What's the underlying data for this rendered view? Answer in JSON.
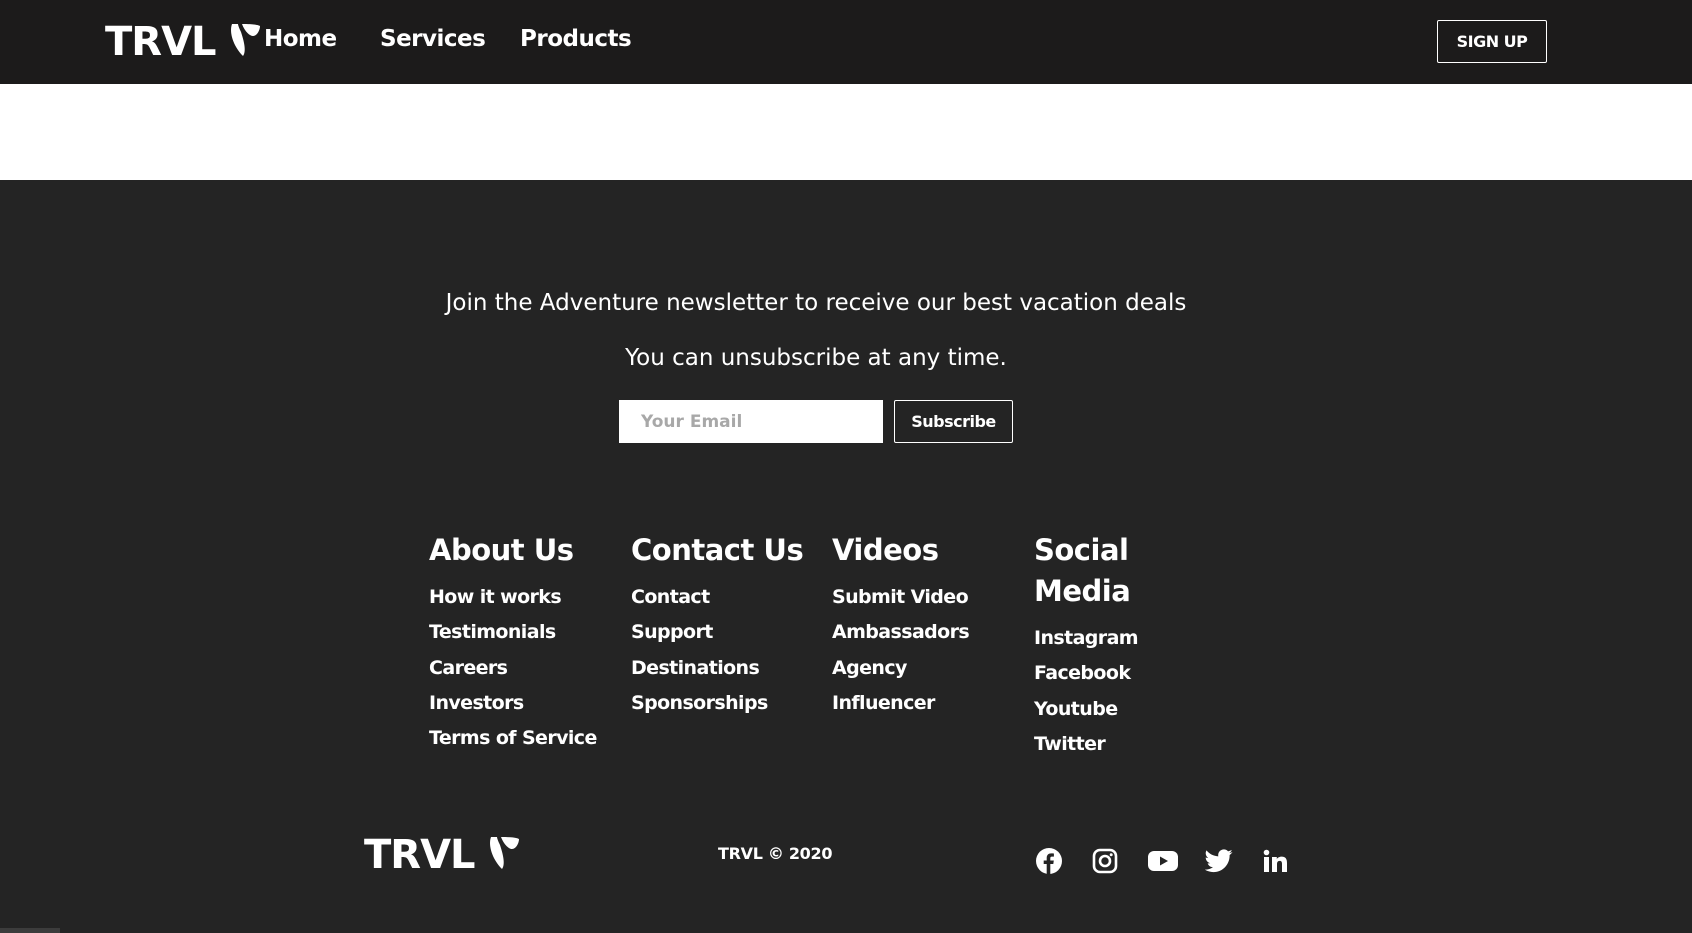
{
  "nav": {
    "brand": "TRVL",
    "links": [
      "Home",
      "Services",
      "Products"
    ],
    "signup_label": "SIGN UP"
  },
  "newsletter": {
    "heading": "Join the Adventure newsletter to receive our best vacation deals",
    "subheading": "You can unsubscribe at any time.",
    "email_placeholder": "Your Email",
    "subscribe_label": "Subscribe"
  },
  "footer_columns": [
    {
      "title": "About Us",
      "links": [
        "How it works",
        "Testimonials",
        "Careers",
        "Investors",
        "Terms of Service"
      ]
    },
    {
      "title": "Contact Us",
      "links": [
        "Contact",
        "Support",
        "Destinations",
        "Sponsorships"
      ]
    },
    {
      "title": "Videos",
      "links": [
        "Submit Video",
        "Ambassadors",
        "Agency",
        "Influencer"
      ]
    },
    {
      "title": "Social Media",
      "links": [
        "Instagram",
        "Facebook",
        "Youtube",
        "Twitter"
      ]
    }
  ],
  "footer": {
    "brand": "TRVL",
    "copyright": "TRVL © 2020",
    "social_icons": [
      "facebook-icon",
      "instagram-icon",
      "youtube-icon",
      "twitter-icon",
      "linkedin-icon"
    ]
  },
  "colors": {
    "navbar_bg": "#1c1b1b",
    "footer_bg": "#242424",
    "band_bg": "#ffffff",
    "text": "#ffffff"
  }
}
